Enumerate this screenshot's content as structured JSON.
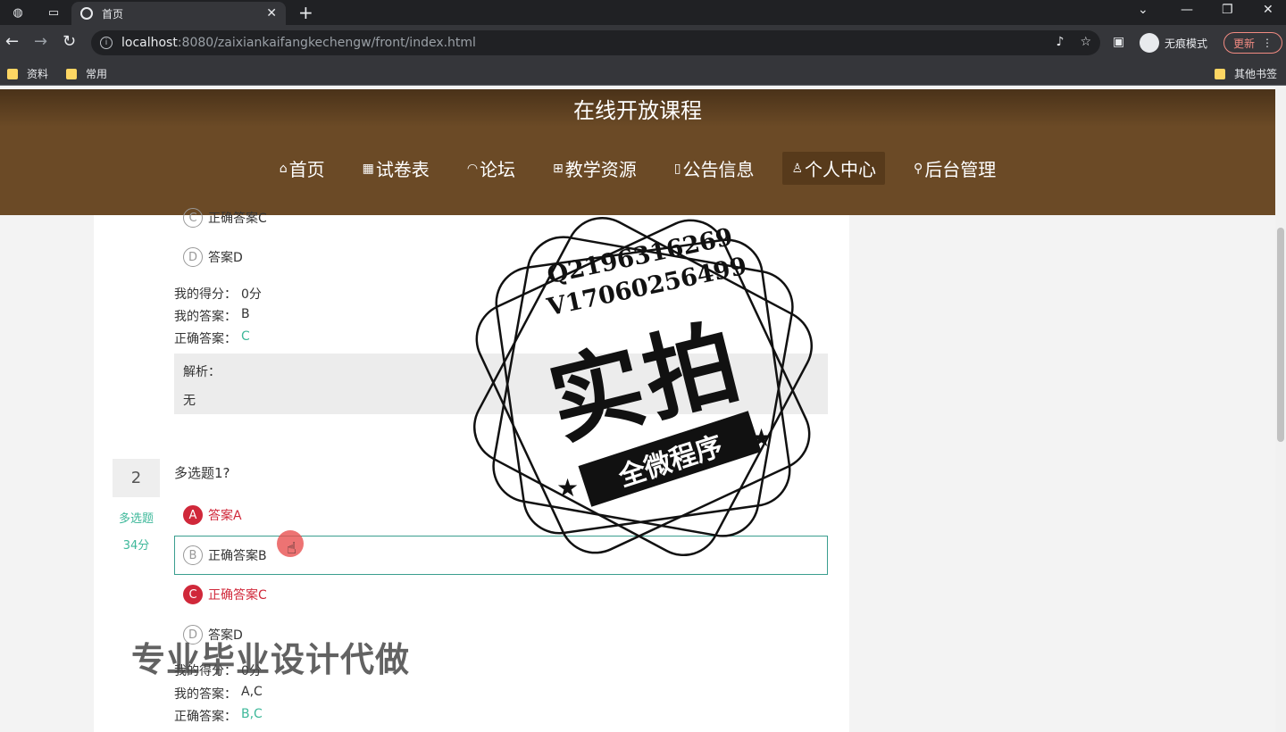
{
  "browser": {
    "tab_title": "首页",
    "url_host": "localhost",
    "url_rest": ":8080/zaixiankaifangkechengw/front/index.html",
    "incognito_label": "无痕模式",
    "update_label": "更新",
    "bookmarks": [
      "资料",
      "常用"
    ],
    "other_bookmarks": "其他书签"
  },
  "site": {
    "title": "在线开放课程",
    "nav": [
      {
        "label": "首页",
        "icon": "⌂"
      },
      {
        "label": "试卷表",
        "icon": "▦"
      },
      {
        "label": "论坛",
        "icon": "◠"
      },
      {
        "label": "教学资源",
        "icon": "⊞"
      },
      {
        "label": "公告信息",
        "icon": "▯"
      },
      {
        "label": "个人中心",
        "icon": "♙"
      },
      {
        "label": "后台管理",
        "icon": "⚲"
      }
    ]
  },
  "question1": {
    "options": [
      {
        "letter": "C",
        "text": "正确答案C"
      },
      {
        "letter": "D",
        "text": "答案D"
      }
    ],
    "my_score_label": "我的得分：",
    "my_score": "0分",
    "my_answer_label": "我的答案：",
    "my_answer": "B",
    "correct_label": "正确答案：",
    "correct": "C",
    "analysis_label": "解析：",
    "analysis": "无"
  },
  "question2": {
    "number": "2",
    "type": "多选题",
    "score": "34分",
    "title": "多选题1?",
    "options": [
      {
        "letter": "A",
        "text": "答案A"
      },
      {
        "letter": "B",
        "text": "正确答案B"
      },
      {
        "letter": "C",
        "text": "正确答案C"
      },
      {
        "letter": "D",
        "text": "答案D"
      }
    ],
    "my_score_label": "我的得分：",
    "my_score": "0分",
    "my_answer_label": "我的答案：",
    "my_answer": "A,C",
    "correct_label": "正确答案：",
    "correct": "B,C"
  },
  "watermark": {
    "line1": "Q2196316269",
    "line2": "V17060256499",
    "big": "实拍",
    "ribbon": "全微程序",
    "overlay": "专业毕业设计代做"
  }
}
